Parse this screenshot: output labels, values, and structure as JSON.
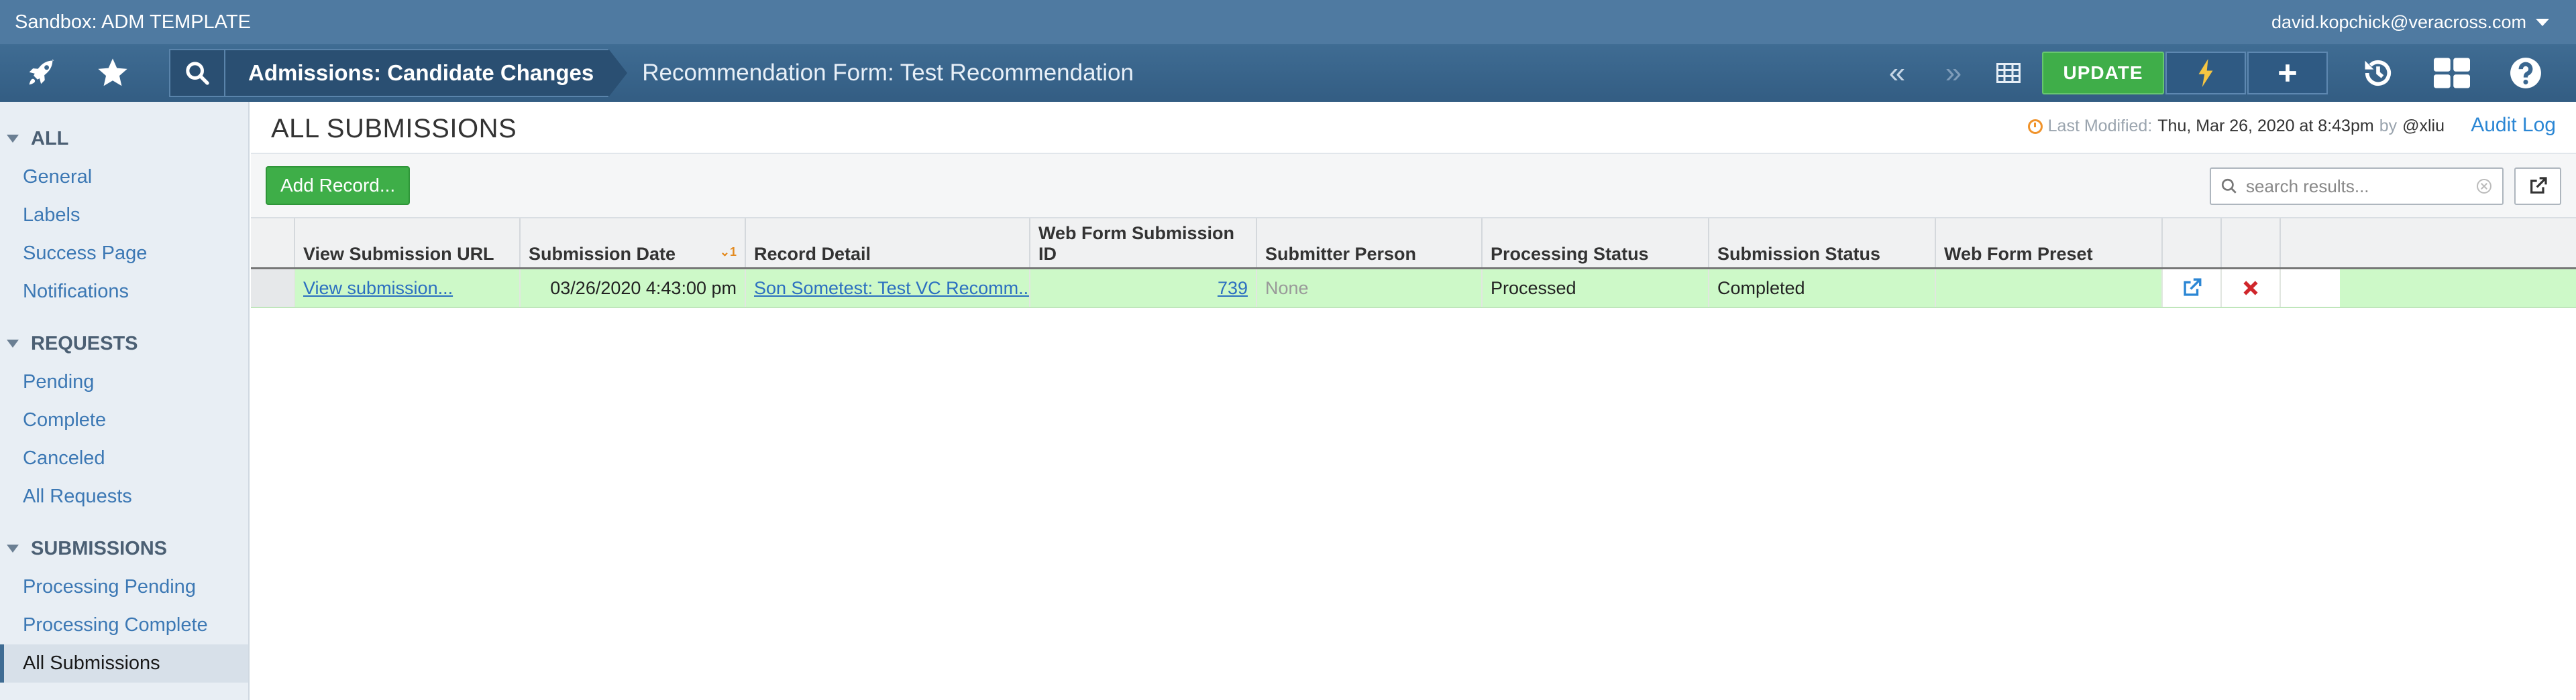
{
  "app": {
    "title": "Sandbox: ADM TEMPLATE",
    "user": "david.kopchick@veracross.com"
  },
  "nav": {
    "breadcrumb_primary": "Admissions: Candidate Changes",
    "breadcrumb_secondary": "Recommendation Form: Test Recommendation",
    "update_label": "UPDATE",
    "icons": [
      "rocket-icon",
      "star-icon",
      "search-icon",
      "double-chevron-left-icon",
      "double-chevron-right-icon",
      "grid-icon",
      "lightning-icon",
      "plus-icon",
      "history-icon",
      "dashboard-icon",
      "help-icon"
    ]
  },
  "sidebar": {
    "sections": [
      {
        "title": "ALL",
        "items": [
          "General",
          "Labels",
          "Success Page",
          "Notifications"
        ]
      },
      {
        "title": "REQUESTS",
        "items": [
          "Pending",
          "Complete",
          "Canceled",
          "All Requests"
        ]
      },
      {
        "title": "SUBMISSIONS",
        "items": [
          "Processing Pending",
          "Processing Complete",
          "All Submissions"
        ]
      }
    ],
    "active_item": "All Submissions"
  },
  "page": {
    "title": "ALL SUBMISSIONS",
    "last_modified_label": "Last Modified:",
    "last_modified_value": "Thu, Mar 26, 2020 at 8:43pm",
    "by_label": "by",
    "modified_by": "@xliu",
    "audit_log": "Audit Log"
  },
  "toolbar": {
    "add_record": "Add Record...",
    "search_placeholder": "search results..."
  },
  "table": {
    "columns": [
      "View Submission URL",
      "Submission Date",
      "Record Detail",
      "Web Form Submission ID",
      "Submitter Person",
      "Processing Status",
      "Submission Status",
      "Web Form Preset"
    ],
    "sort_indicator": "1",
    "rows": [
      {
        "view_url": "View submission...",
        "submission_date": "03/26/2020 4:43:00 pm",
        "record_detail": "Son Sometest: Test VC Recomm...",
        "submission_id": "739",
        "submitter": "None",
        "processing_status": "Processed",
        "submission_status": "Completed",
        "preset": ""
      }
    ]
  },
  "colors": {
    "header_bar": "#4f7aa1",
    "navbar": "#3a6790",
    "update_green": "#3fae49",
    "row_highlight": "#cdf9c8",
    "link": "#2b6fc0",
    "delete_red": "#d0262b"
  }
}
